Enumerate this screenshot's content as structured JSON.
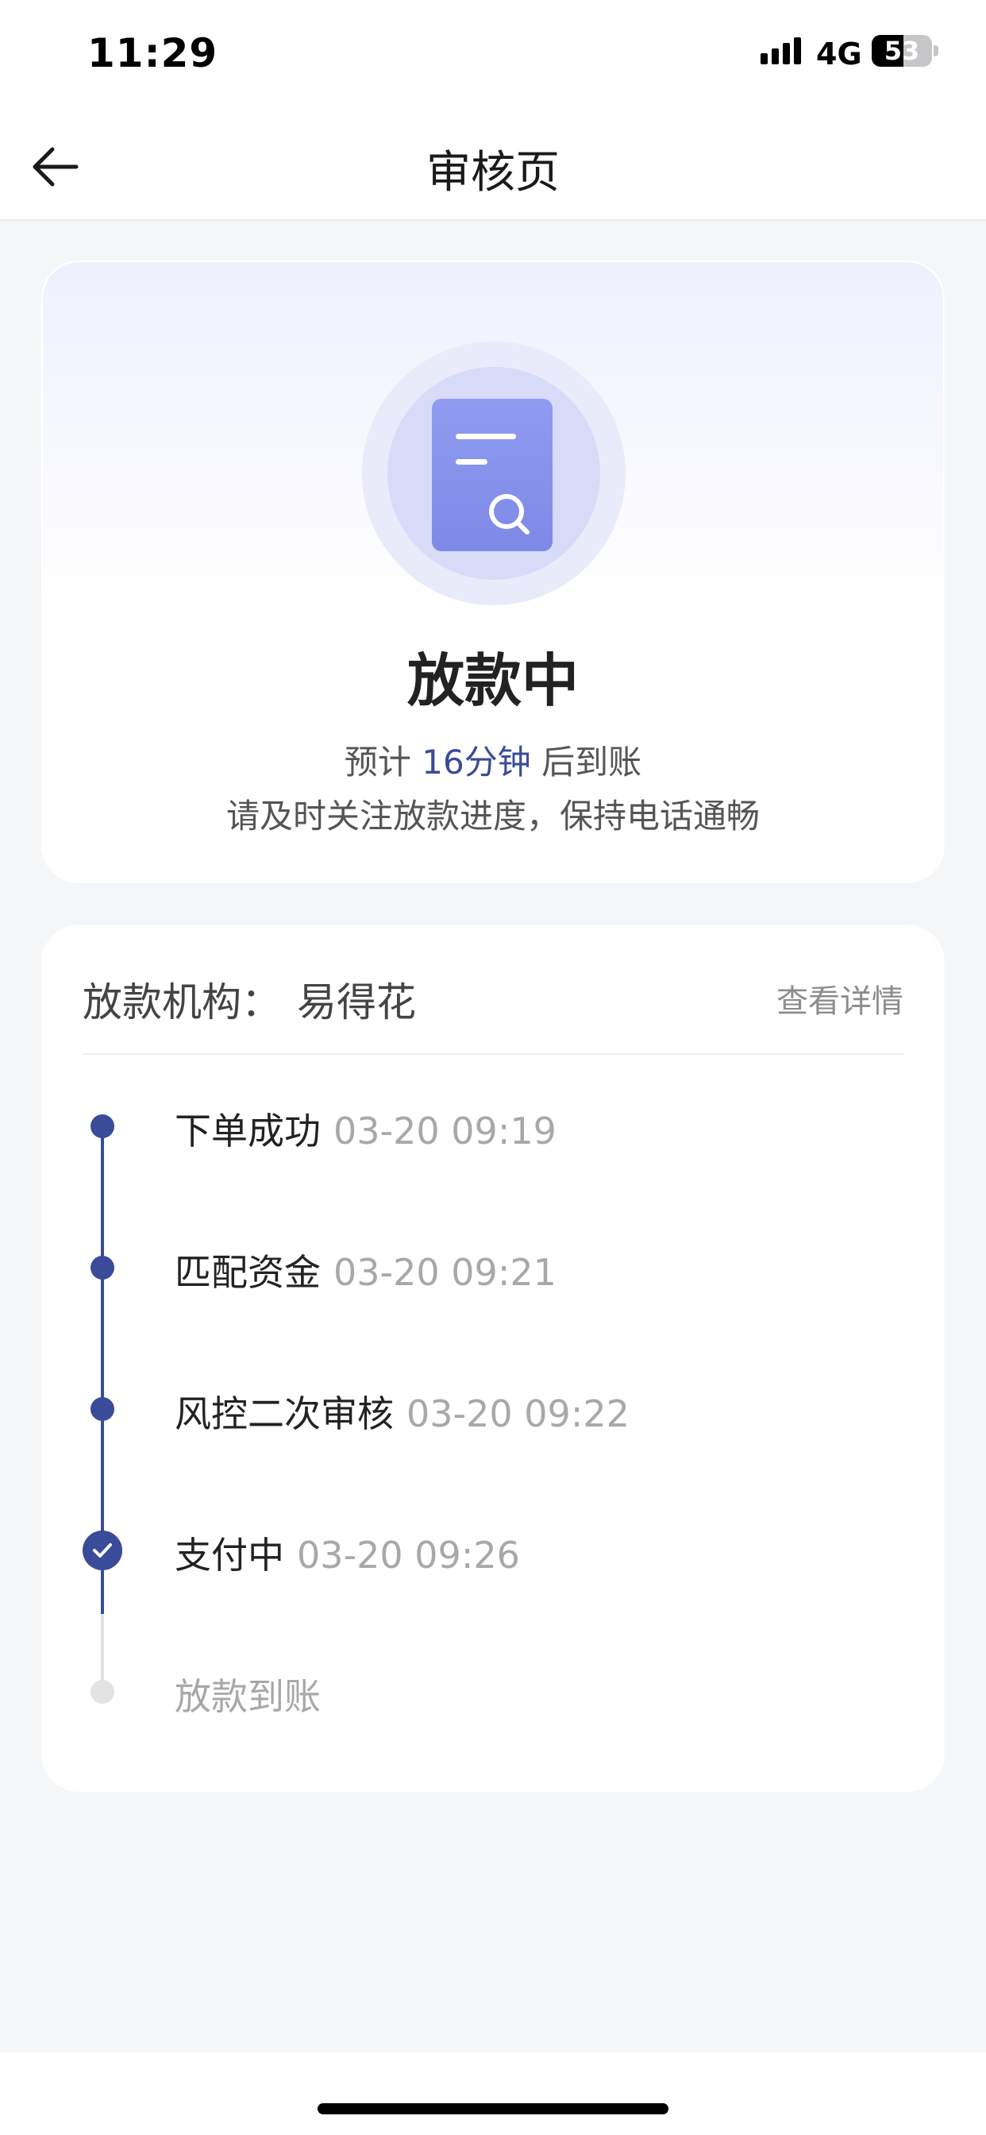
{
  "status_bar": {
    "time": "11:29",
    "network": "4G",
    "battery_level": "53"
  },
  "nav": {
    "title": "审核页",
    "back_icon": "arrow-left-icon"
  },
  "status_card": {
    "illustration_icon": "document-search-icon",
    "title": "放款中",
    "eta_prefix": "预计",
    "eta_value": "16分钟",
    "eta_suffix": "后到账",
    "note": "请及时关注放款进度，保持电话通畅",
    "accent_color": "#3a4b9a"
  },
  "progress_card": {
    "lender_label": "放款机构：",
    "lender_name": "易得花",
    "details_link": "查看详情",
    "steps": [
      {
        "name": "下单成功",
        "time": "03-20 09:19",
        "state": "done"
      },
      {
        "name": "匹配资金",
        "time": "03-20 09:21",
        "state": "done"
      },
      {
        "name": "风控二次审核",
        "time": "03-20 09:22",
        "state": "done"
      },
      {
        "name": "支付中",
        "time": "03-20 09:26",
        "state": "current"
      },
      {
        "name": "放款到账",
        "time": "",
        "state": "pending"
      }
    ],
    "colors": {
      "done": "#3a4b9a",
      "pending": "#e3e3e3"
    }
  }
}
